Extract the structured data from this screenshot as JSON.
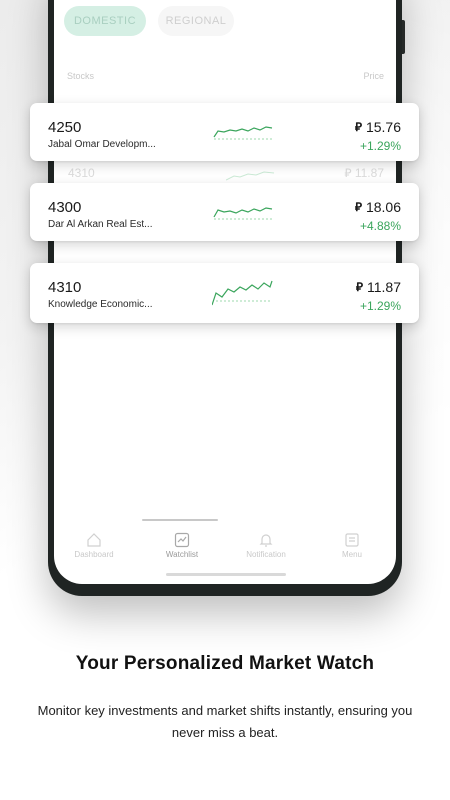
{
  "segments": {
    "domestic": "DOMESTIC",
    "regional": "REGIONAL"
  },
  "columns": {
    "stocks": "Stocks",
    "price": "Price"
  },
  "ghost_rows": [
    {
      "symbol": "4310",
      "price": "⃁ 11.87"
    }
  ],
  "currency_symbol": "⃁",
  "cards": [
    {
      "symbol": "4250",
      "name": "Jabal Omar Developm...",
      "price": "15.76",
      "change": "+1.29%"
    },
    {
      "symbol": "4300",
      "name": "Dar Al Arkan Real Est...",
      "price": "18.06",
      "change": "+4.88%"
    },
    {
      "symbol": "4310",
      "name": "Knowledge Economic...",
      "price": "11.87",
      "change": "+1.29%"
    }
  ],
  "tabs": [
    {
      "label": "Dashboard",
      "icon": "home-icon"
    },
    {
      "label": "Watchlist",
      "icon": "chart-icon"
    },
    {
      "label": "Notification",
      "icon": "bell-icon"
    },
    {
      "label": "Menu",
      "icon": "list-icon"
    }
  ],
  "headline": "Your Personalized Market Watch",
  "subtext": "Monitor key investments and market shifts instantly, ensuring you never miss a beat.",
  "colors": {
    "accent_green": "#3aa55c",
    "segment_active_bg": "#d5efe4"
  }
}
